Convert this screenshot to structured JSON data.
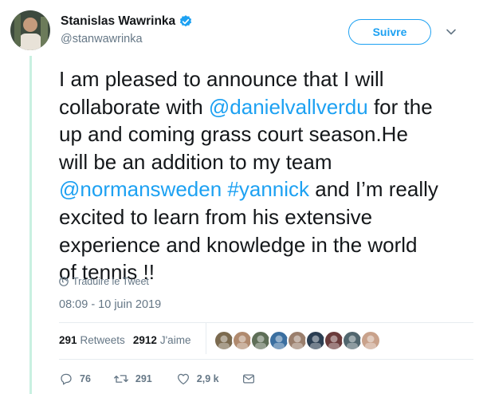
{
  "author": {
    "name": "Stanislas Wawrinka",
    "handle": "@stanwawrinka",
    "verified_icon": "verified-badge-icon"
  },
  "follow_button": {
    "label": "Suivre"
  },
  "tweet": {
    "lines": [
      [
        {
          "t": "I am pleased to announce that I will",
          "m": false
        }
      ],
      [
        {
          "t": "collaborate with ",
          "m": false
        },
        {
          "t": "@danielvallverdu",
          "m": true
        },
        {
          "t": " for the",
          "m": false
        }
      ],
      [
        {
          "t": "up and coming grass court season.He",
          "m": false
        }
      ],
      [
        {
          "t": "will be an addition to my team",
          "m": false
        }
      ],
      [
        {
          "t": "@normansweden",
          "m": true
        },
        {
          "t": " ",
          "m": false
        },
        {
          "t": "#yannick",
          "m": true
        },
        {
          "t": " and I’m really",
          "m": false
        }
      ],
      [
        {
          "t": "excited to learn from his extensive",
          "m": false
        }
      ],
      [
        {
          "t": "experience and knowledge in the world",
          "m": false
        }
      ],
      [
        {
          "t": "of tennis !!",
          "m": false
        }
      ]
    ],
    "translate_label": "Traduire le Tweet",
    "timestamp": "08:09 - 10 juin 2019"
  },
  "stats": {
    "retweets_count": "291",
    "retweets_label": "Retweets",
    "likes_count": "2912",
    "likes_label": "J'aime",
    "liker_avatar_colors": [
      "#7b6a4f",
      "#b08a6e",
      "#5e6e57",
      "#3b6fa0",
      "#9a7e6c",
      "#2b3e52",
      "#6a3b3b",
      "#51666e",
      "#c9a28b"
    ]
  },
  "actions": {
    "replies": "76",
    "retweets": "291",
    "likes": "2,9 k"
  },
  "colors": {
    "accent": "#1da1f2",
    "secondary_text": "#657786",
    "thread_line": "#c9f0e1"
  }
}
